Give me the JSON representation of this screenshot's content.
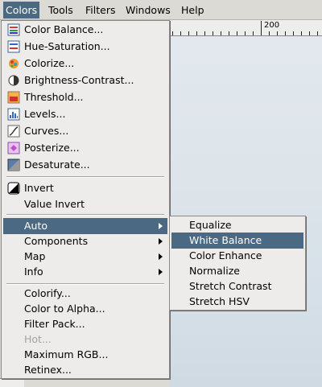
{
  "menubar": {
    "items": [
      {
        "label": "Colors"
      },
      {
        "label": "Tools"
      },
      {
        "label": "Filters"
      },
      {
        "label": "Windows"
      },
      {
        "label": "Help"
      }
    ]
  },
  "ruler": {
    "label": "200"
  },
  "colors_menu": {
    "items": [
      {
        "label": "Color Balance...",
        "icon": "color-balance-icon"
      },
      {
        "label": "Hue-Saturation...",
        "icon": "hue-saturation-icon"
      },
      {
        "label": "Colorize...",
        "icon": "colorize-icon"
      },
      {
        "label": "Brightness-Contrast...",
        "icon": "brightness-contrast-icon"
      },
      {
        "label": "Threshold...",
        "icon": "threshold-icon"
      },
      {
        "label": "Levels...",
        "icon": "levels-icon"
      },
      {
        "label": "Curves...",
        "icon": "curves-icon"
      },
      {
        "label": "Posterize...",
        "icon": "posterize-icon"
      },
      {
        "label": "Desaturate...",
        "icon": "desaturate-icon"
      },
      {
        "label": "Invert",
        "icon": "invert-icon"
      },
      {
        "label": "Value Invert"
      },
      {
        "label": "Auto"
      },
      {
        "label": "Components"
      },
      {
        "label": "Map"
      },
      {
        "label": "Info"
      },
      {
        "label": "Colorify..."
      },
      {
        "label": "Color to Alpha..."
      },
      {
        "label": "Filter Pack..."
      },
      {
        "label": "Hot..."
      },
      {
        "label": "Maximum RGB..."
      },
      {
        "label": "Retinex..."
      }
    ]
  },
  "auto_submenu": {
    "items": [
      {
        "label": "Equalize"
      },
      {
        "label": "White Balance"
      },
      {
        "label": "Color Enhance"
      },
      {
        "label": "Normalize"
      },
      {
        "label": "Stretch Contrast"
      },
      {
        "label": "Stretch HSV"
      }
    ]
  },
  "colors": {
    "highlight": "#4b6983",
    "menu_bg": "#edecea",
    "disabled_text": "#a3a29c"
  }
}
